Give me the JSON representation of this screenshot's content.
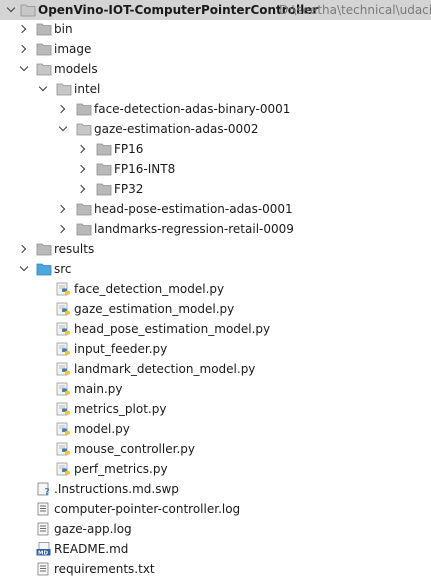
{
  "project": {
    "name": "OpenVino-IOT-ComputerPointerController",
    "path": "D:\\seetha\\technical\\udacity\\"
  },
  "tree": {
    "bin": "bin",
    "image": "image",
    "models": "models",
    "intel": "intel",
    "face_detection": "face-detection-adas-binary-0001",
    "gaze_estimation": "gaze-estimation-adas-0002",
    "fp16": "FP16",
    "fp16_int8": "FP16-INT8",
    "fp32": "FP32",
    "head_pose": "head-pose-estimation-adas-0001",
    "landmarks": "landmarks-regression-retail-0009",
    "results": "results",
    "src": "src",
    "src_files": [
      "face_detection_model.py",
      "gaze_estimation_model.py",
      "head_pose_estimation_model.py",
      "input_feeder.py",
      "landmark_detection_model.py",
      "main.py",
      "metrics_plot.py",
      "model.py",
      "mouse_controller.py",
      "perf_metrics.py"
    ],
    "swp_file": ".Instructions.md.swp",
    "log_file": "computer-pointer-controller.log",
    "gaze_log": "gaze-app.log",
    "readme": "README.md",
    "requirements": "requirements.txt"
  }
}
